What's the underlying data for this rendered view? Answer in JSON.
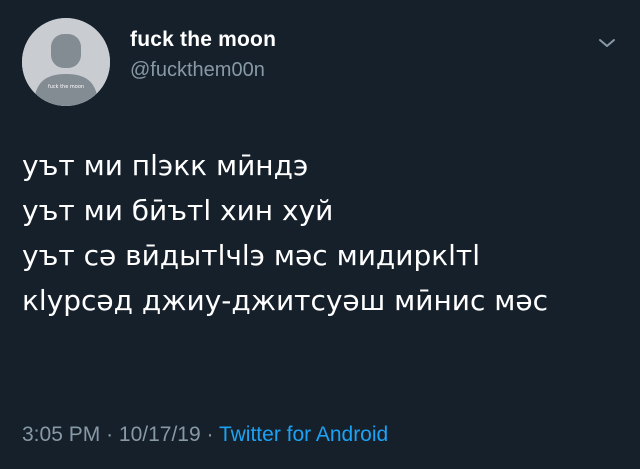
{
  "tweet": {
    "author": {
      "display_name": "fuck the moon",
      "handle": "@fuckthem00n",
      "avatar_caption": "fuck the moon",
      "avatar_icon": "default-profile-silhouette"
    },
    "menu_icon": "chevron-down",
    "body_lines": [
      "уът ми пӏэкк мӣндэ",
      "уът ми бӣътӏ хин хуй",
      "уът сә вӣдытӏчӏэ мәс мидиркӏтӏ",
      "кӏурсәд джиу-джитсуәш мӣнис мәс"
    ],
    "meta": {
      "time": "3:05 PM",
      "separator": "·",
      "date": "10/17/19",
      "source": "Twitter for Android"
    }
  },
  "colors": {
    "background": "#15202b",
    "text": "#ffffff",
    "secondary_text": "#8899a6",
    "link": "#1da1f2"
  }
}
